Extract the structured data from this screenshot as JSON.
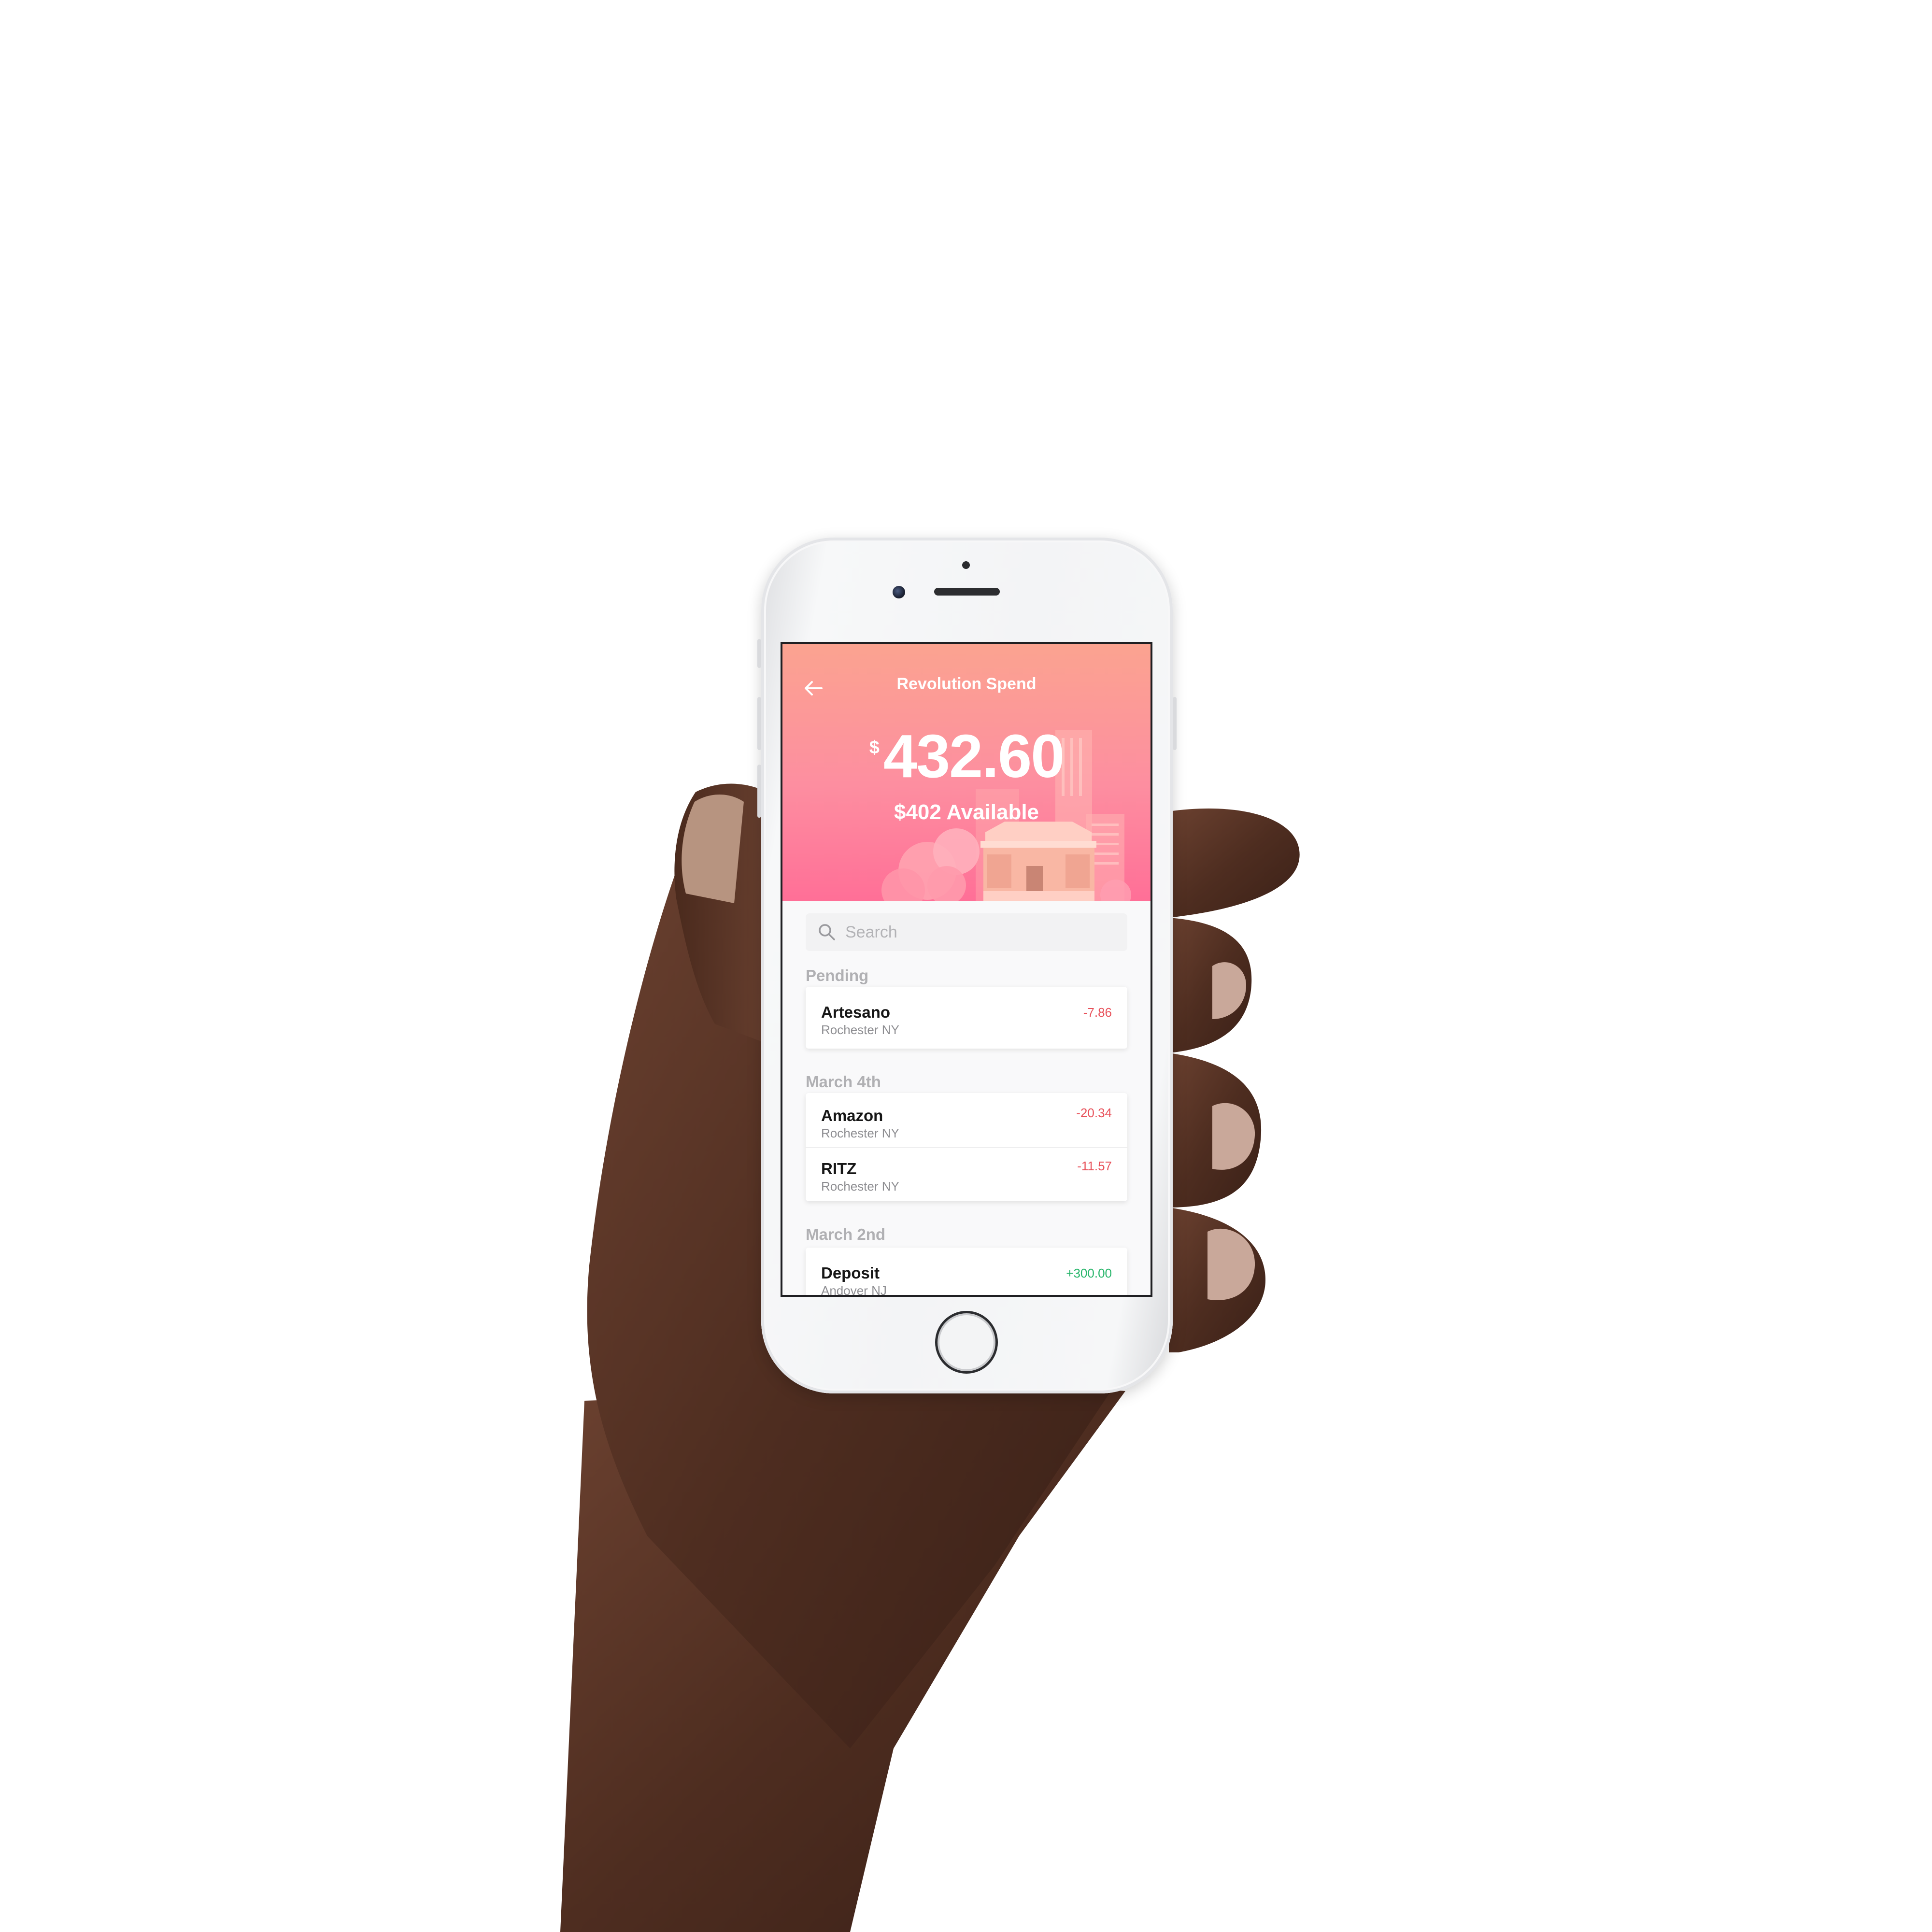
{
  "app": {
    "title": "Revolution Spend"
  },
  "balance": {
    "currency_symbol": "$",
    "amount": "432.60",
    "available": "$402 Available"
  },
  "search": {
    "placeholder": "Search"
  },
  "sections": [
    {
      "label": "Pending",
      "transactions": [
        {
          "merchant": "Artesano",
          "location": "Rochester NY",
          "amount": "-7.86",
          "type": "debit"
        }
      ]
    },
    {
      "label": "March 4th",
      "transactions": [
        {
          "merchant": "Amazon",
          "location": "Rochester NY",
          "amount": "-20.34",
          "type": "debit"
        },
        {
          "merchant": "RITZ",
          "location": "Rochester NY",
          "amount": "-11.57",
          "type": "debit"
        }
      ]
    },
    {
      "label": "March 2nd",
      "transactions": [
        {
          "merchant": "Deposit",
          "location": "Andover NJ",
          "amount": "+300.00",
          "type": "credit"
        }
      ]
    }
  ],
  "icons": {
    "back": "arrow-left-icon",
    "search": "search-icon"
  },
  "colors": {
    "header_top": "#fba390",
    "header_bottom": "#ff6f97",
    "debit": "#e8515a",
    "credit": "#27b56a"
  }
}
